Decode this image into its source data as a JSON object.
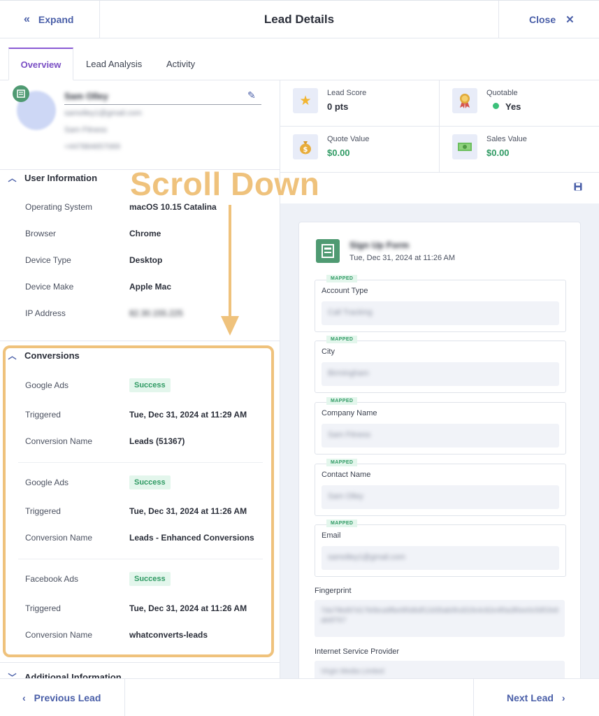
{
  "header": {
    "expand_label": "Expand",
    "title": "Lead Details",
    "close_label": "Close"
  },
  "tabs": [
    {
      "label": "Overview"
    },
    {
      "label": "Lead Analysis"
    },
    {
      "label": "Activity"
    }
  ],
  "profile": {
    "name": "Sam Olley",
    "email": "samolley1@gmail.com",
    "company": "Sam Fitness",
    "phone": "+447884657069"
  },
  "user_information": {
    "title": "User Information",
    "rows": [
      {
        "key": "Operating System",
        "value": "macOS 10.15 Catalina"
      },
      {
        "key": "Browser",
        "value": "Chrome"
      },
      {
        "key": "Device Type",
        "value": "Desktop"
      },
      {
        "key": "Device Make",
        "value": "Apple Mac"
      },
      {
        "key": "IP Address",
        "value": "82.30.155.225"
      }
    ]
  },
  "conversions": {
    "title": "Conversions",
    "items": [
      {
        "source": "Google Ads",
        "status": "Success",
        "triggered_label": "Triggered",
        "triggered": "Tue, Dec 31, 2024 at 11:29 AM",
        "name_label": "Conversion Name",
        "name": "Leads (51367)"
      },
      {
        "source": "Google Ads",
        "status": "Success",
        "triggered_label": "Triggered",
        "triggered": "Tue, Dec 31, 2024 at 11:26 AM",
        "name_label": "Conversion Name",
        "name": "Leads - Enhanced Conversions"
      },
      {
        "source": "Facebook Ads",
        "status": "Success",
        "triggered_label": "Triggered",
        "triggered": "Tue, Dec 31, 2024 at 11:26 AM",
        "name_label": "Conversion Name",
        "name": "whatconverts-leads"
      }
    ]
  },
  "additional_information": {
    "title": "Additional Information"
  },
  "annotation": {
    "text": "Scroll Down",
    "color": "#efc27c"
  },
  "stats": [
    {
      "label": "Lead Score",
      "value": "0 pts",
      "icon": "star-icon"
    },
    {
      "label": "Quotable",
      "value": "Yes",
      "icon": "award-ribbon-icon"
    },
    {
      "label": "Quote Value",
      "value": "$0.00",
      "icon": "money-bag-icon"
    },
    {
      "label": "Sales Value",
      "value": "$0.00",
      "icon": "banknote-icon"
    }
  ],
  "form": {
    "title": "Sign Up Form",
    "date": "Tue, Dec 31, 2024 at 11:26 AM",
    "mapped_label": "MAPPED",
    "fields": [
      {
        "label": "Account Type",
        "value": "Call Tracking"
      },
      {
        "label": "City",
        "value": "Birmingham"
      },
      {
        "label": "Company Name",
        "value": "Sam Fitness"
      },
      {
        "label": "Contact Name",
        "value": "Sam Olley"
      },
      {
        "label": "Email",
        "value": "samolley1@gmail.com"
      }
    ],
    "fingerprint": {
      "label": "Fingerprint",
      "value": "7da79bd97d17b0bca9fbe6f0d6df12d35ab0fcd31fe4c82e4f0a3f0ee0c59f1fe8ab6f767"
    },
    "isp": {
      "label": "Internet Service Provider",
      "value": "Virgin Media Limited"
    }
  },
  "footer": {
    "prev_label": "Previous Lead",
    "next_label": "Next Lead"
  },
  "colors": {
    "accent": "#4a5fa8",
    "tab_active": "#7a4fc4",
    "success": "#2f9a63",
    "form_icon": "#4f9a72"
  }
}
